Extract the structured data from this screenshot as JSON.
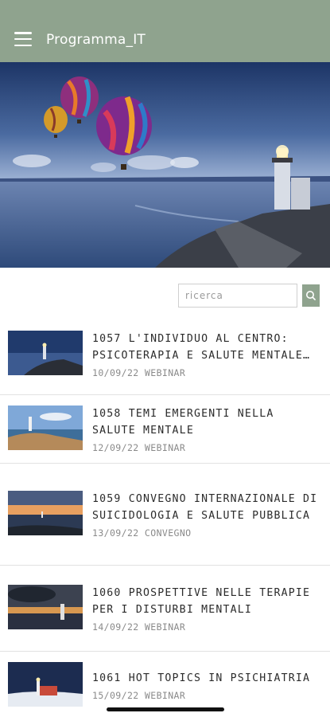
{
  "header": {
    "title": "Programma_IT",
    "menu_icon": "hamburger-menu-icon",
    "background": "#8fa38e"
  },
  "hero": {
    "image": "hot-air-balloons-lighthouse-photo"
  },
  "search": {
    "placeholder": "ricerca",
    "button_icon": "search-icon"
  },
  "events": [
    {
      "title": "1057 L'INDIVIDUO AL CENTRO: PSICOTERAPIA E SALUTE MENTALE…",
      "date": "10/09/22",
      "type": "WEBINAR",
      "thumb": "lighthouse-coast-night"
    },
    {
      "title": "1058 TEMI EMERGENTI NELLA SALUTE MENTALE",
      "date": "12/09/22",
      "type": "WEBINAR",
      "thumb": "lighthouse-rocky-beach"
    },
    {
      "title": "1059 CONVEGNO INTERNAZIONALE DI SUICIDOLOGIA E SALUTE PUBBLICA",
      "date": "13/09/22",
      "type": "CONVEGNO",
      "thumb": "lighthouse-sunset"
    },
    {
      "title": "1060 PROSPETTIVE NELLE TERAPIE PER I DISTURBI MENTALI",
      "date": "14/09/22",
      "type": "WEBINAR",
      "thumb": "lighthouse-stormy-sky"
    },
    {
      "title": "1061 HOT TOPICS IN PSICHIATRIA",
      "date": "15/09/22",
      "type": "WEBINAR",
      "thumb": "lighthouse-winter-night"
    }
  ]
}
